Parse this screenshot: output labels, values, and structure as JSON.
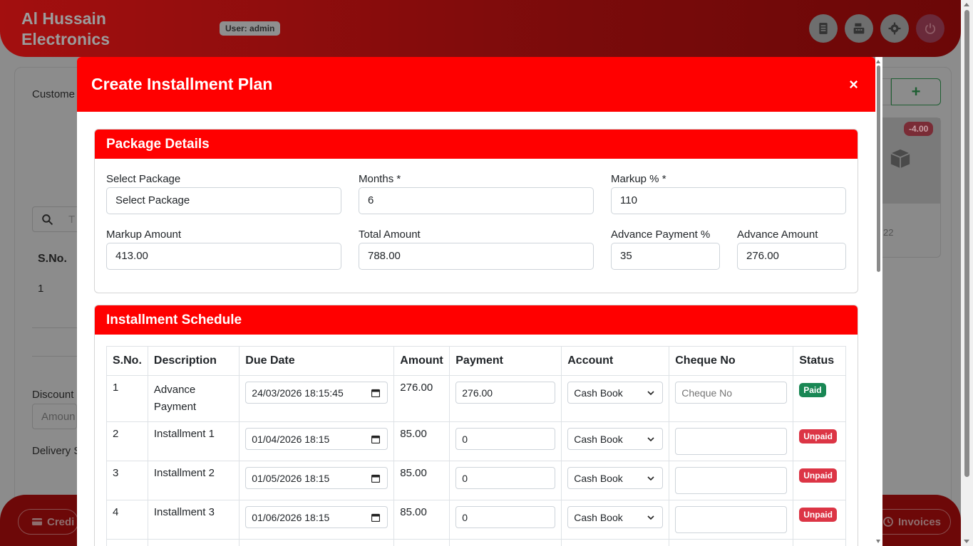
{
  "app": {
    "brand_line1": "Al Hussain",
    "brand_line2": "Electronics",
    "user_badge": "User: admin"
  },
  "background": {
    "customer_label": "Custome",
    "search_placeholder": "T",
    "table_sno_header": "S.No.",
    "table_first_row": "1",
    "discount_label": "Discount",
    "amount_placeholder": "Amoun",
    "delivery_label": "Delivery S",
    "stock_badge": "-4.00",
    "product_code": "22",
    "footer_left_label": "Credi",
    "footer_right_label": "Invoices"
  },
  "modal": {
    "title": "Create Installment Plan",
    "close": "×"
  },
  "package": {
    "header": "Package Details",
    "select_package_label": "Select Package",
    "select_package_value": "Select Package",
    "months_label": "Months *",
    "months_value": "6",
    "markup_pct_label": "Markup % *",
    "markup_pct_value": "110",
    "markup_amount_label": "Markup Amount",
    "markup_amount_value": "413.00",
    "total_amount_label": "Total Amount",
    "total_amount_value": "788.00",
    "advance_pct_label": "Advance Payment %",
    "advance_pct_value": "35",
    "advance_amount_label": "Advance Amount",
    "advance_amount_value": "276.00"
  },
  "schedule": {
    "header": "Installment Schedule",
    "columns": [
      "S.No.",
      "Description",
      "Due Date",
      "Amount",
      "Payment",
      "Account",
      "Cheque No",
      "Status"
    ],
    "cheque_placeholder": "Cheque No",
    "rows": [
      {
        "sno": "1",
        "description": "Advance Payment",
        "due_date": "24/03/2026 18:15:45",
        "amount": "276.00",
        "payment": "276.00",
        "account": "Cash Book",
        "cheque": "",
        "status": "Paid"
      },
      {
        "sno": "2",
        "description": "Installment 1",
        "due_date": "01/04/2026 18:15",
        "amount": "85.00",
        "payment": "0",
        "account": "Cash Book",
        "cheque": "",
        "status": "Unpaid"
      },
      {
        "sno": "3",
        "description": "Installment 2",
        "due_date": "01/05/2026 18:15",
        "amount": "85.00",
        "payment": "0",
        "account": "Cash Book",
        "cheque": "",
        "status": "Unpaid"
      },
      {
        "sno": "4",
        "description": "Installment 3",
        "due_date": "01/06/2026 18:15",
        "amount": "85.00",
        "payment": "0",
        "account": "Cash Book",
        "cheque": "",
        "status": "Unpaid"
      }
    ]
  },
  "colors": {
    "accent_red": "#ff0000",
    "paid_green": "#198754",
    "unpaid_red": "#dc3545"
  }
}
